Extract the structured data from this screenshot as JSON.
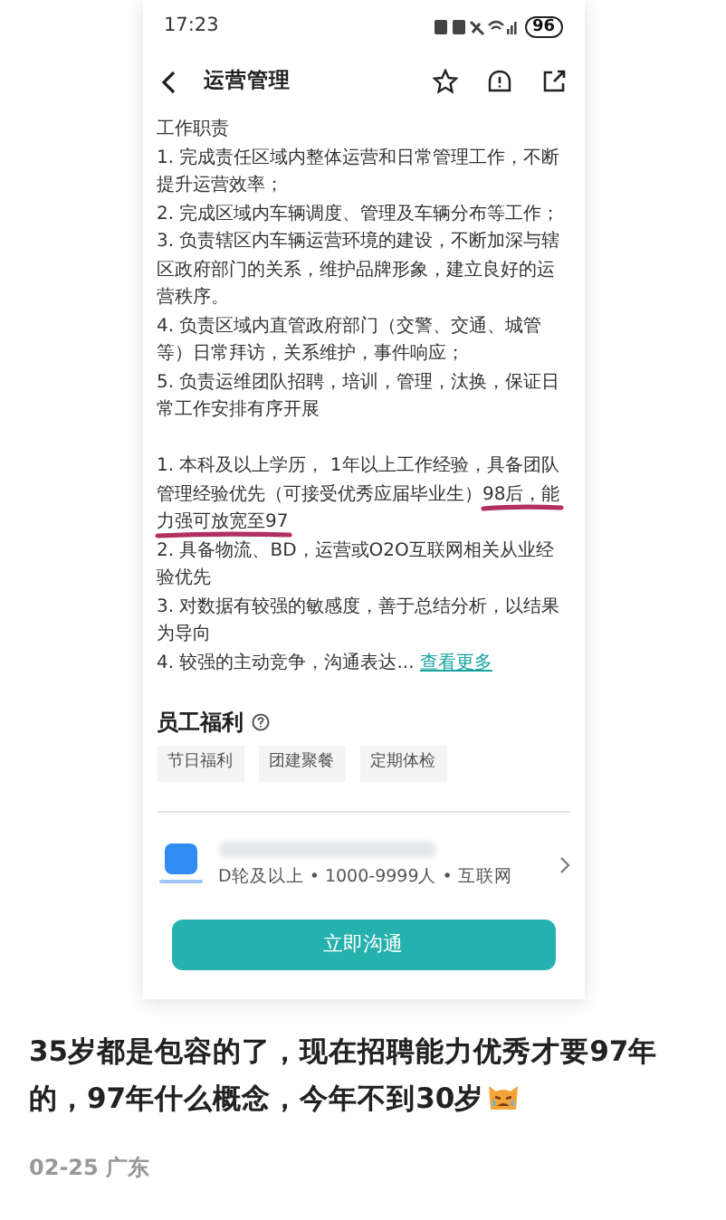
{
  "status_bar": {
    "time": "17:23",
    "battery": "96"
  },
  "header": {
    "title": "运营管理"
  },
  "description": {
    "heading": "工作职责",
    "duties": [
      "1. 完成责任区域内整体运营和日常管理工作，不断提升运营效率；",
      "2. 完成区域内车辆调度、管理及车辆分布等工作；",
      "3. 负责辖区内车辆运营环境的建设，不断加深与辖区政府部门的关系，维护品牌形象，建立良好的运营秩序。",
      "4. 负责区域内直管政府部门（交警、交通、城管等）日常拜访，关系维护，事件响应；",
      "5. 负责运维团队招聘，培训，管理，汰换，保证日常工作安排有序开展"
    ],
    "requirements": [
      {
        "parts": [
          {
            "text": "1. 本科及以上学历， 1年以上工作经验，具备团队管理经验优先（可接受优秀应届毕业生）",
            "underlined": false
          },
          {
            "text": "98后，能力强可放宽至97",
            "underlined": true
          }
        ]
      },
      {
        "parts": [
          {
            "text": "2. 具备物流、BD，运营或O2O互联网相关从业经验优先",
            "underlined": false
          }
        ]
      },
      {
        "parts": [
          {
            "text": "3. 对数据有较强的敏感度，善于总结分析，以结果为导向",
            "underlined": false
          }
        ]
      },
      {
        "parts": [
          {
            "text": "4. 较强的主动竞争，沟通表达...",
            "underlined": false
          }
        ]
      }
    ],
    "more_link": "查看更多"
  },
  "benefits": {
    "heading": "员工福利",
    "tags": [
      "节日福利",
      "团建聚餐",
      "定期体检"
    ]
  },
  "company": {
    "info": "D轮及以上 • 1000-9999人 • 互联网"
  },
  "action_button": "立即沟通",
  "post": {
    "text": "35岁都是包容的了，现在招聘能力优秀才要97年的，97年什么概念，今年不到30岁",
    "meta": "02-25 广东"
  }
}
